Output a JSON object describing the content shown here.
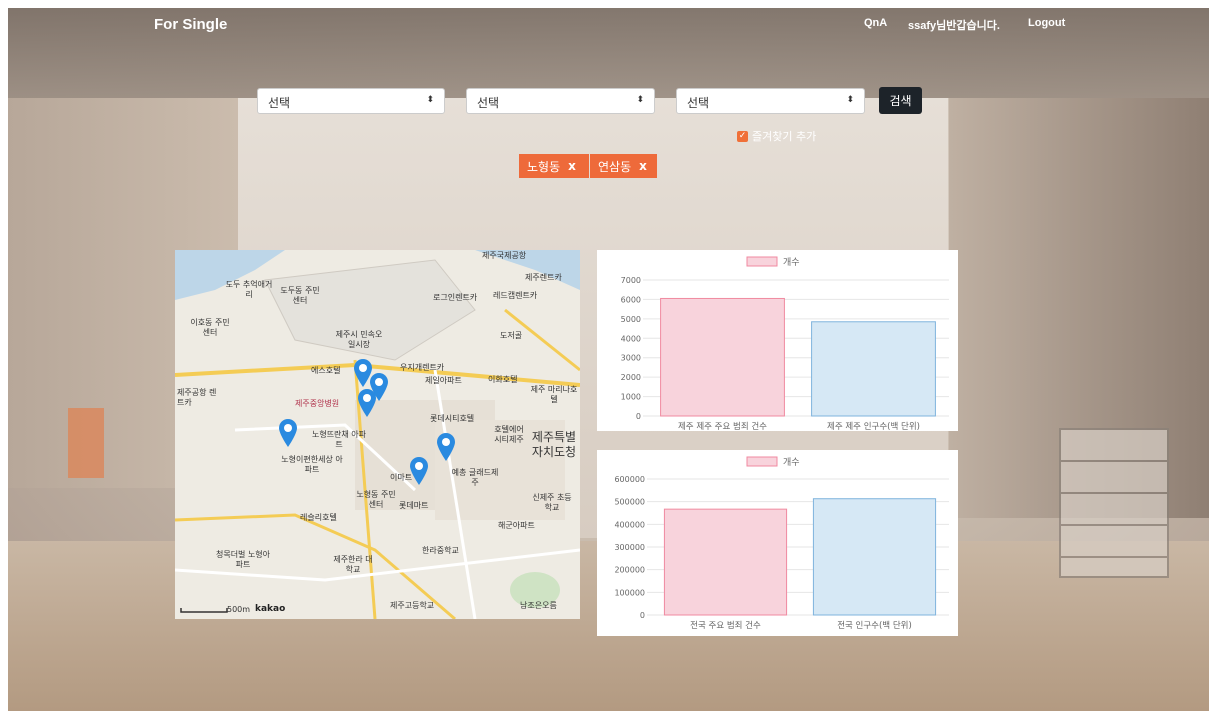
{
  "header": {
    "brand": "For Single",
    "qna": "QnA",
    "greeting": "ssafy님반갑습니다.",
    "logout": "Logout"
  },
  "filters": {
    "select1": "선택",
    "select2": "선택",
    "select3": "선택",
    "search_label": "검색",
    "favorite_label": "즐겨찾기 추가"
  },
  "tags": [
    {
      "label": "노형동",
      "close": "x"
    },
    {
      "label": "연삼동",
      "close": "x"
    }
  ],
  "map": {
    "scale_label": "500m",
    "provider": "kakao",
    "labels": [
      "도두 추억애거리",
      "도두동 주민센터",
      "이호동 주민센터",
      "로그인렌트카",
      "레드캡렌트카",
      "제주렌트카",
      "제주시 민속오일시장",
      "도저골",
      "에스호텔",
      "우지개렌트카",
      "제일아파트",
      "이화호텔",
      "제주 마리나호텔",
      "제주공항 렌트카",
      "제주중앙병원",
      "롯데시티호텔",
      "노형뜨란채 아파트",
      "호텔에어 시티제주",
      "제주특별 자치도청",
      "노형이편한세상 아파트",
      "이마트",
      "예총 글래드제주",
      "노형동 주민센터",
      "롯데마트",
      "신제주 초등학교",
      "레슬리호텔",
      "해군아파트",
      "한라중학교",
      "청목더벌 노형아파트",
      "제주한라 대학교",
      "제주고등학교",
      "남조은오름",
      "제주국제공항"
    ]
  },
  "chart_data": [
    {
      "type": "bar",
      "legend": "개수",
      "categories": [
        "제주 제주 주요 범죄 건수",
        "제주 제주 인구수(백 단위)"
      ],
      "values": [
        6050,
        4850
      ],
      "ylim": [
        0,
        7000
      ],
      "yticks": [
        "0",
        "1000",
        "2000",
        "3000",
        "4000",
        "5000",
        "6000",
        "7000"
      ],
      "colors": {
        "bar1_fill": "#f8d3dc",
        "bar1_stroke": "#f08aa0",
        "bar2_fill": "#d6e8f5",
        "bar2_stroke": "#7fb3dd"
      }
    },
    {
      "type": "bar",
      "legend": "개수",
      "categories": [
        "전국 주요 범죄 건수",
        "전국 인구수(백 단위)"
      ],
      "values": [
        467000,
        513000
      ],
      "ylim": [
        0,
        600000
      ],
      "yticks": [
        "0",
        "100000",
        "200000",
        "300000",
        "400000",
        "500000",
        "600000"
      ],
      "colors": {
        "bar1_fill": "#f8d3dc",
        "bar1_stroke": "#f08aa0",
        "bar2_fill": "#d6e8f5",
        "bar2_stroke": "#7fb3dd"
      }
    }
  ]
}
